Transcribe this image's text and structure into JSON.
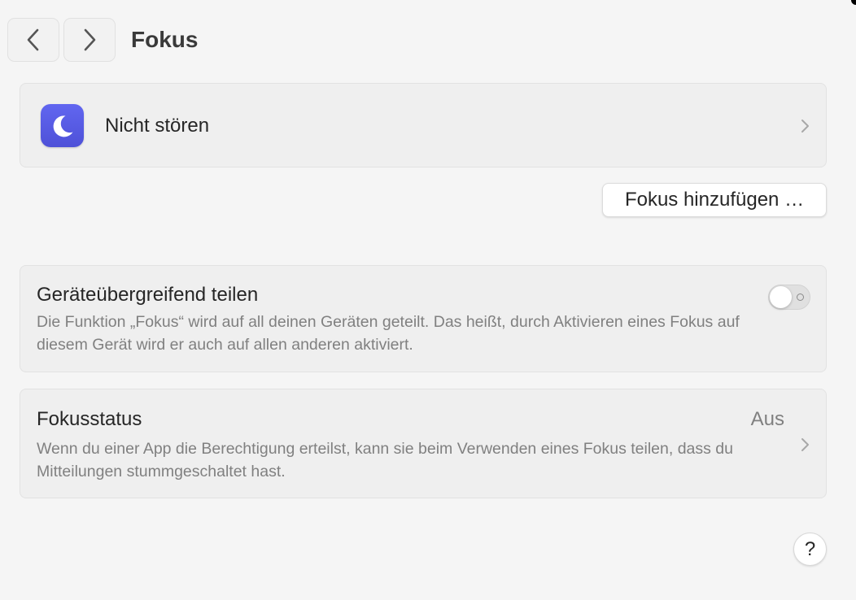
{
  "toolbar": {
    "title": "Fokus",
    "back_icon": "chevron-left-icon",
    "forward_icon": "chevron-right-icon"
  },
  "focus_list": {
    "items": [
      {
        "label": "Nicht stören",
        "icon": "moon-icon",
        "icon_color": "#5b5fe8"
      }
    ]
  },
  "add_focus": {
    "label": "Fokus hinzufügen …"
  },
  "share_across_devices": {
    "title": "Geräteübergreifend teilen",
    "description": "Die Funktion „Fokus“ wird auf all deinen Geräten geteilt. Das heißt, durch Aktivieren eines Fokus auf diesem Gerät wird er auch auf allen anderen aktiviert.",
    "enabled": false
  },
  "focus_status": {
    "title": "Fokusstatus",
    "value": "Aus",
    "description": "Wenn du einer App die Berechtigung erteilst, kann sie beim Verwenden eines Fokus teilen, dass du Mitteilungen stummgeschaltet hast."
  },
  "help": {
    "label": "?"
  }
}
